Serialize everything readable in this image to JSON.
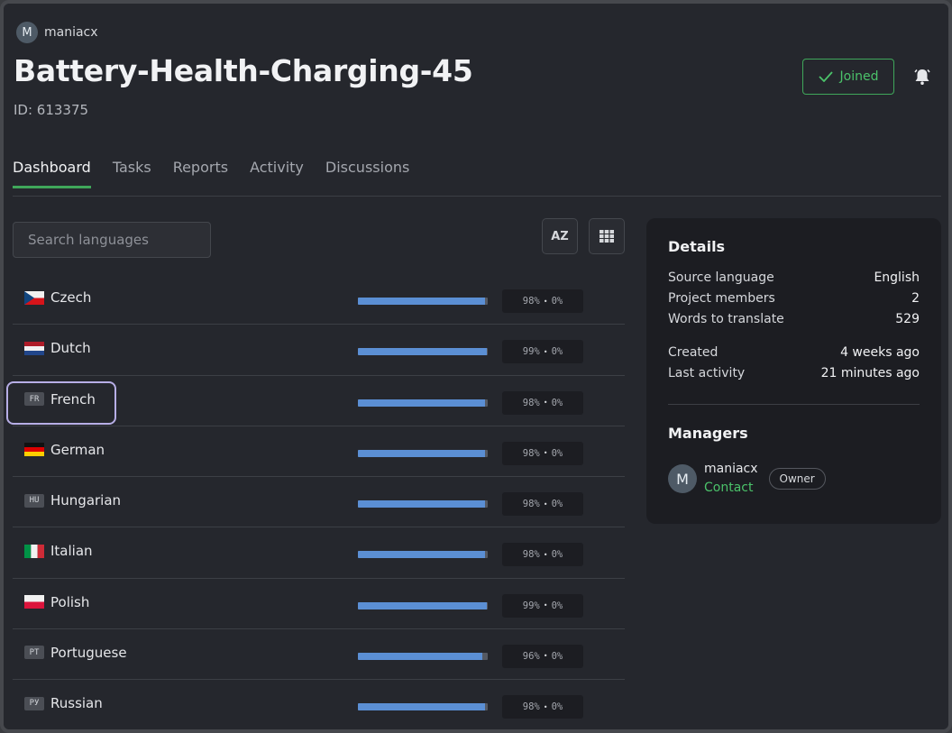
{
  "header": {
    "owner_initial": "M",
    "owner_name": "maniacx",
    "title": "Battery-Health-Charging-45",
    "project_id": "ID: 613375",
    "joined_label": "Joined"
  },
  "tabs": [
    {
      "label": "Dashboard",
      "active": true
    },
    {
      "label": "Tasks",
      "active": false
    },
    {
      "label": "Reports",
      "active": false
    },
    {
      "label": "Activity",
      "active": false
    },
    {
      "label": "Discussions",
      "active": false
    }
  ],
  "search": {
    "placeholder": "Search languages"
  },
  "toolbar": {
    "sort_label": "AZ",
    "sort_icon": "sort-az-icon",
    "grid_icon": "grid-view-icon"
  },
  "languages": [
    {
      "name": "Czech",
      "flag": "cz",
      "progress": 98,
      "translated": "98%",
      "approved": "0%"
    },
    {
      "name": "Dutch",
      "flag": "nl",
      "progress": 99,
      "translated": "99%",
      "approved": "0%"
    },
    {
      "name": "French",
      "flag": "code",
      "code": "FR",
      "progress": 98,
      "translated": "98%",
      "approved": "0%",
      "focused": true
    },
    {
      "name": "German",
      "flag": "de",
      "progress": 98,
      "translated": "98%",
      "approved": "0%"
    },
    {
      "name": "Hungarian",
      "flag": "code",
      "code": "HU",
      "progress": 98,
      "translated": "98%",
      "approved": "0%"
    },
    {
      "name": "Italian",
      "flag": "it",
      "progress": 98,
      "translated": "98%",
      "approved": "0%"
    },
    {
      "name": "Polish",
      "flag": "pl",
      "progress": 99,
      "translated": "99%",
      "approved": "0%"
    },
    {
      "name": "Portuguese",
      "flag": "code",
      "code": "PT",
      "progress": 96,
      "translated": "96%",
      "approved": "0%"
    },
    {
      "name": "Russian",
      "flag": "code",
      "code": "РУ",
      "progress": 98,
      "translated": "98%",
      "approved": "0%"
    }
  ],
  "details": {
    "title": "Details",
    "source_language_label": "Source language",
    "source_language": "English",
    "members_label": "Project members",
    "members": "2",
    "words_label": "Words to translate",
    "words": "529",
    "created_label": "Created",
    "created": "4 weeks ago",
    "last_activity_label": "Last activity",
    "last_activity": "21 minutes ago",
    "managers_title": "Managers",
    "manager_initial": "M",
    "manager_name": "maniacx",
    "manager_contact": "Contact",
    "manager_role": "Owner"
  },
  "colors": {
    "accent_green": "#4bc26a",
    "progress_blue": "#5b8fd4",
    "background": "#25272d",
    "panel": "#1c1d22"
  }
}
